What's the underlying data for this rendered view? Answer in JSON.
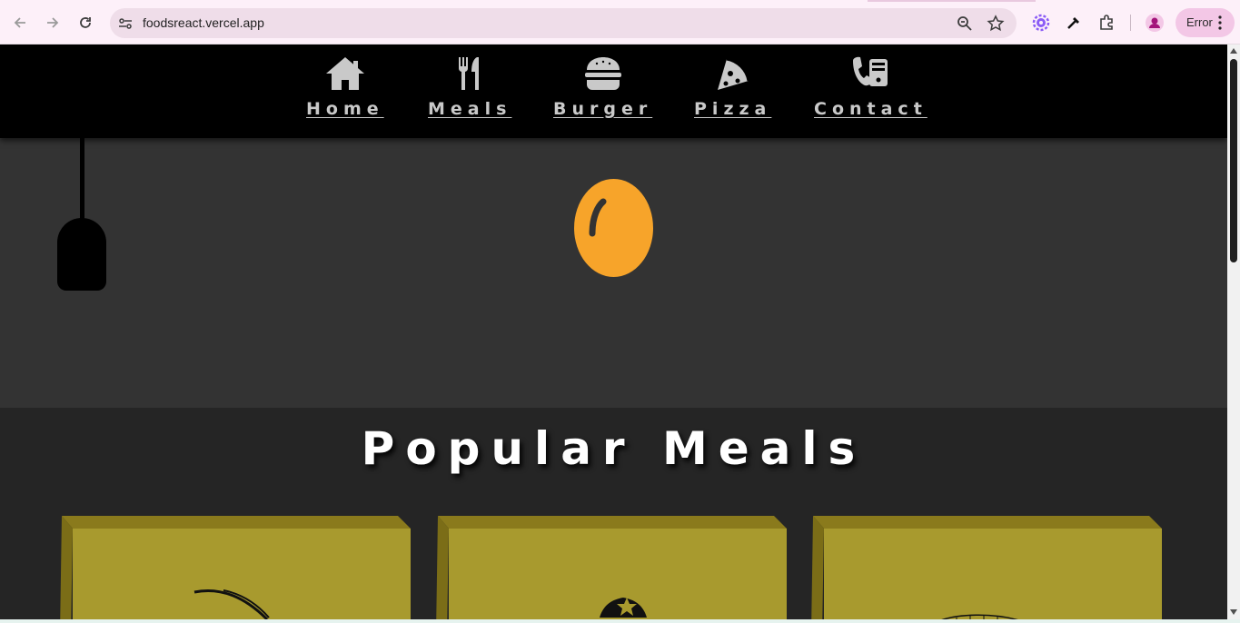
{
  "browser": {
    "url": "foodsreact.vercel.app",
    "profile_status": "Error",
    "icons": [
      "back-arrow-icon",
      "forward-arrow-icon",
      "reload-icon",
      "site-settings-icon",
      "zoom-icon",
      "bookmark-star-icon",
      "extension-gear-icon",
      "eyedropper-icon",
      "puzzle-extensions-icon",
      "profile-avatar-icon",
      "more-vert-icon"
    ],
    "accent": "#fdf0f9"
  },
  "nav": {
    "items": [
      {
        "label": "Home",
        "icon": "home-icon"
      },
      {
        "label": "Meals",
        "icon": "utensils-icon"
      },
      {
        "label": "Burger",
        "icon": "burger-icon"
      },
      {
        "label": "Pizza",
        "icon": "pizza-icon"
      },
      {
        "label": "Contact",
        "icon": "phone-icon"
      }
    ]
  },
  "popular": {
    "title": "Popular Meals",
    "card_color": "#a89a2e"
  }
}
